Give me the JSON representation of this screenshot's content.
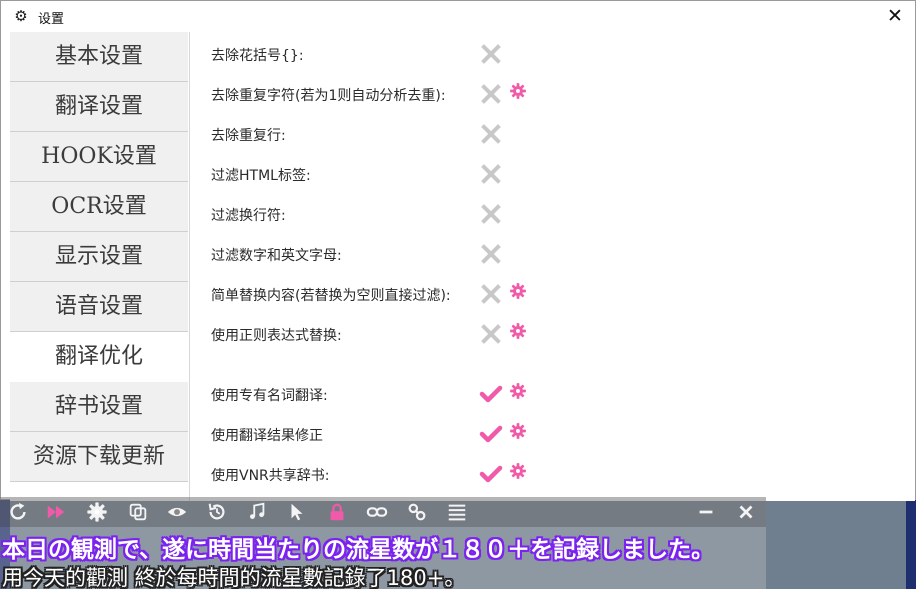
{
  "window": {
    "title": "设置",
    "close_glyph": "✕"
  },
  "sidebar": {
    "items": [
      {
        "label": "基本设置",
        "active": false
      },
      {
        "label": "翻译设置",
        "active": false
      },
      {
        "label": "HOOK设置",
        "active": false
      },
      {
        "label": "OCR设置",
        "active": false
      },
      {
        "label": "显示设置",
        "active": false
      },
      {
        "label": "语音设置",
        "active": false
      },
      {
        "label": "翻译优化",
        "active": true
      },
      {
        "label": "辞书设置",
        "active": false
      },
      {
        "label": "资源下载更新",
        "active": false
      }
    ]
  },
  "options": [
    {
      "label": "去除花括号{}:",
      "enabled": false,
      "has_settings": false
    },
    {
      "label": "去除重复字符(若为1则自动分析去重):",
      "enabled": false,
      "has_settings": true
    },
    {
      "label": "去除重复行:",
      "enabled": false,
      "has_settings": false
    },
    {
      "label": "过滤HTML标签:",
      "enabled": false,
      "has_settings": false
    },
    {
      "label": "过滤换行符:",
      "enabled": false,
      "has_settings": false
    },
    {
      "label": "过滤数字和英文字母:",
      "enabled": false,
      "has_settings": false
    },
    {
      "label": "简单替换内容(若替换为空则直接过滤):",
      "enabled": false,
      "has_settings": true
    },
    {
      "label": "使用正则表达式替换:",
      "enabled": false,
      "has_settings": true
    },
    {
      "label": "使用专有名词翻译:",
      "enabled": true,
      "has_settings": true
    },
    {
      "label": "使用翻译结果修正",
      "enabled": true,
      "has_settings": true
    },
    {
      "label": "使用VNR共享辞书:",
      "enabled": true,
      "has_settings": true
    }
  ],
  "toolbar_icons": [
    "refresh-icon",
    "fast-forward-icon",
    "gear-icon",
    "copy-icon",
    "eye-icon",
    "history-icon",
    "music-icon",
    "pointer-icon",
    "lock-icon",
    "link-icon",
    "chain-icon",
    "list-icon",
    "minimize-icon",
    "close-icon"
  ],
  "subtitles": {
    "japanese": "本日の観測で、遂に時間当たりの流星数が１８０＋を記録しました。",
    "chinese": "用今天的觀測 終於每時間的流星數記錄了180+。"
  },
  "colors": {
    "accent": "#f05aa8",
    "disabled": "#c8c8c8",
    "subtitle_outline": "#7b22f0"
  }
}
